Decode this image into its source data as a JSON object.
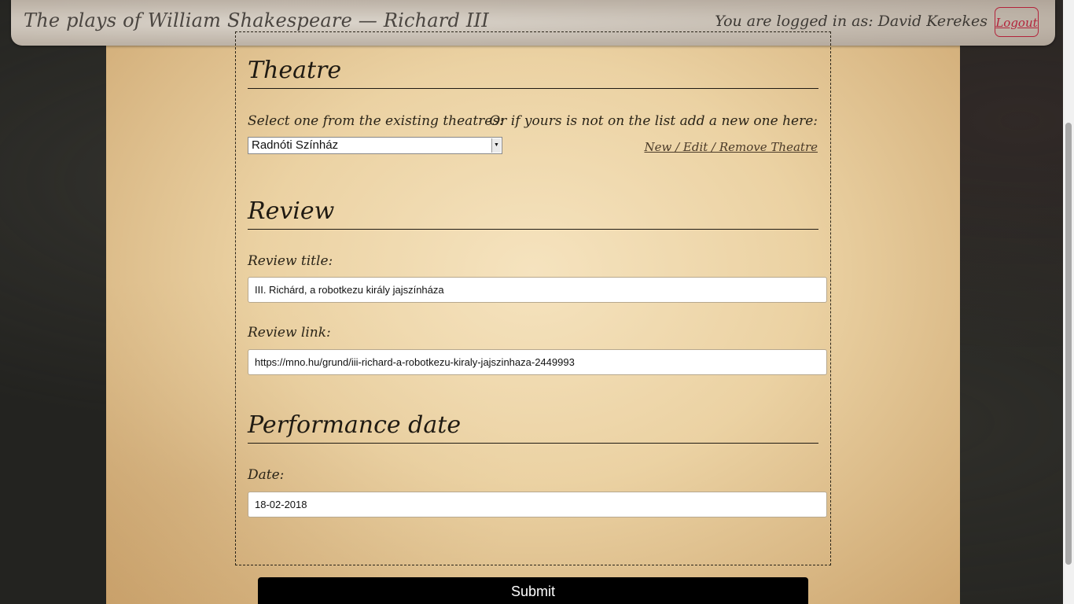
{
  "header": {
    "title": "The plays of William Shakespeare — Richard III",
    "login_text": "You are logged in as: David Kerekes",
    "logout_label": "Logout"
  },
  "theatre_section": {
    "heading": "Theatre",
    "select_label": "Select one from the existing theatres:",
    "selected_theatre": "Radnóti Színház",
    "add_new_label": "Or if yours is not on the list add a new one here:",
    "new_edit_remove_link": "New / Edit / Remove Theatre"
  },
  "review_section": {
    "heading": "Review",
    "title_label": "Review title:",
    "title_value": "III. Richárd, a robotkezu király jajszínháza",
    "link_label": "Review link:",
    "link_value": "https://mno.hu/grund/iii-richard-a-robotkezu-kiraly-jajszinhaza-2449993"
  },
  "performance_section": {
    "heading": "Performance date",
    "date_label": "Date:",
    "date_value": "18-02-2018"
  },
  "submit_label": "Submit",
  "colors": {
    "logout_accent": "#b3233b",
    "submit_background": "#000000",
    "parchment": "#e9cfa0"
  }
}
